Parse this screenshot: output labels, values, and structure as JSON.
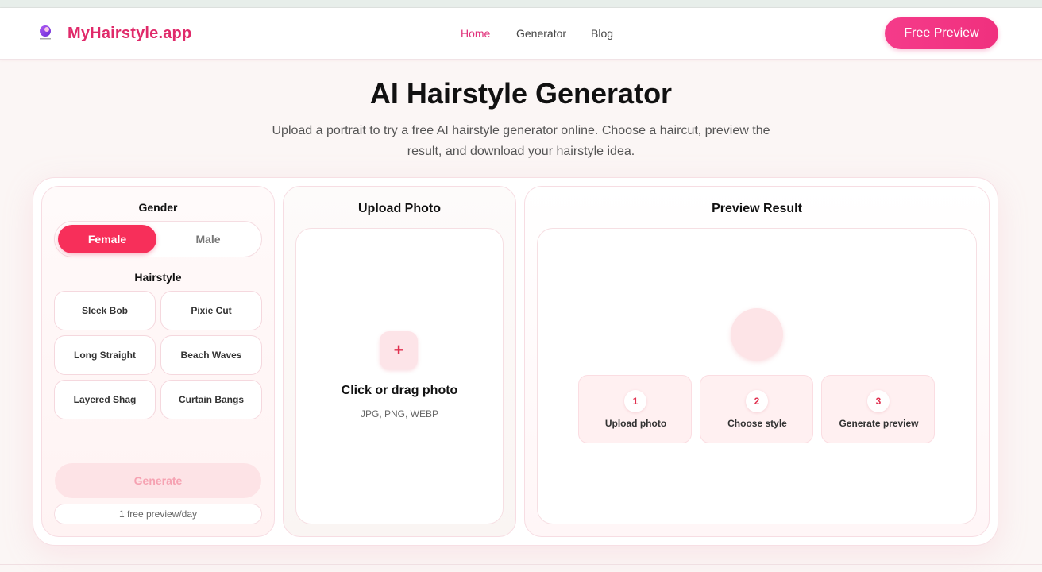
{
  "header": {
    "brand": "MyHairstyle.app",
    "nav": [
      {
        "label": "Home",
        "active": true
      },
      {
        "label": "Generator",
        "active": false
      },
      {
        "label": "Blog",
        "active": false
      }
    ],
    "cta_label": "Free Preview"
  },
  "hero": {
    "title": "AI Hairstyle Generator",
    "subtitle": "Upload a portrait to try a free AI hairstyle generator online. Choose a haircut, preview the result, and download your hairstyle idea."
  },
  "left_panel": {
    "gender_label": "Gender",
    "gender_options": [
      "Female",
      "Male"
    ],
    "gender_selected": "Female",
    "hairstyle_label": "Hairstyle",
    "hairstyles": [
      "Sleek Bob",
      "Pixie Cut",
      "Long Straight",
      "Beach Waves",
      "Layered Shag",
      "Curtain Bangs"
    ],
    "generate_label": "Generate",
    "quota_text": "1 free preview/day"
  },
  "upload_panel": {
    "title": "Upload Photo",
    "plus_icon": "+",
    "drop_title": "Click or drag photo",
    "drop_formats": "JPG, PNG, WEBP"
  },
  "preview_panel": {
    "title": "Preview Result",
    "steps": [
      {
        "num": "1",
        "label": "Upload photo"
      },
      {
        "num": "2",
        "label": "Choose style"
      },
      {
        "num": "3",
        "label": "Generate preview"
      }
    ]
  },
  "colors": {
    "brand": "#e02a6a",
    "accent": "#f72f5a",
    "cta": "#f0307e"
  }
}
